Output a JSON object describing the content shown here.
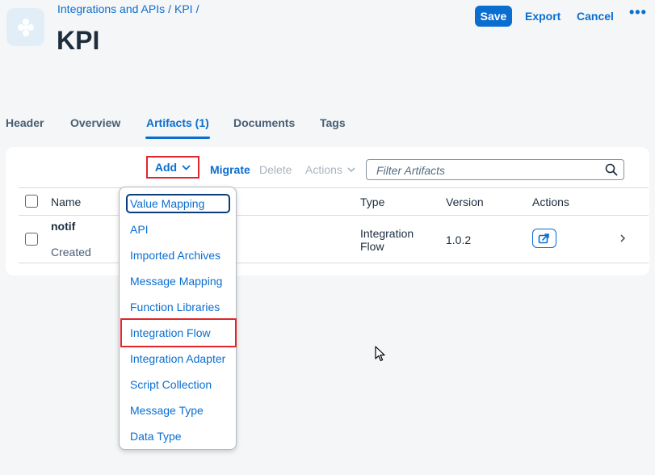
{
  "header": {
    "breadcrumb": [
      "Integrations and APIs",
      "KPI"
    ],
    "breadcrumb_separator": "/",
    "title": "KPI",
    "save_label": "Save",
    "export_label": "Export",
    "cancel_label": "Cancel",
    "more_label": "•••"
  },
  "tabs": [
    {
      "label": "Header",
      "active": false
    },
    {
      "label": "Overview",
      "active": false
    },
    {
      "label": "Artifacts (1)",
      "active": true
    },
    {
      "label": "Documents",
      "active": false
    },
    {
      "label": "Tags",
      "active": false
    }
  ],
  "toolbar": {
    "add_label": "Add",
    "migrate_label": "Migrate",
    "delete_label": "Delete",
    "actions_label": "Actions",
    "search_placeholder": "Filter Artifacts"
  },
  "table": {
    "columns": [
      "Name",
      "Type",
      "Version",
      "Actions"
    ],
    "rows": [
      {
        "name": "notif",
        "status": "Created",
        "type_line1": "Integration",
        "type_line2": "Flow",
        "version": "1.0.2"
      }
    ]
  },
  "add_menu": {
    "items": [
      "Value Mapping",
      "API",
      "Imported Archives",
      "Message Mapping",
      "Function Libraries",
      "Integration Flow",
      "Integration Adapter",
      "Script Collection",
      "Message Type",
      "Data Type"
    ],
    "focused_item": "Value Mapping",
    "highlighted_item": "Integration Flow"
  },
  "colors": {
    "accent": "#0a6ed1",
    "highlight_border": "#e0262b",
    "background": "#f5f6f7"
  }
}
